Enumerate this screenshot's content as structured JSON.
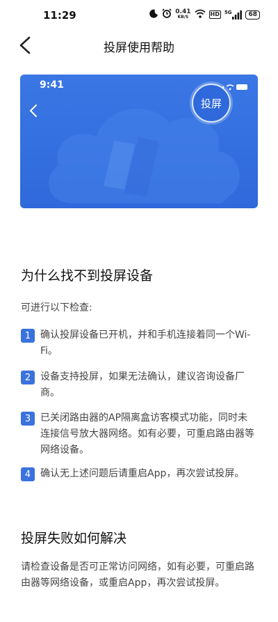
{
  "status_bar": {
    "time": "11:29",
    "speed_value": "0.41",
    "speed_unit": "KB/S",
    "hd": "HD",
    "network": "5G",
    "battery": "68"
  },
  "nav": {
    "title": "投屏使用帮助"
  },
  "banner": {
    "phone_time": "9:41",
    "cast_button": "投屏",
    "colors": {
      "background": "#2f69db",
      "accent": "#3a72de"
    }
  },
  "section1": {
    "title": "为什么找不到投屏设备",
    "intro": "可进行以下检查:",
    "steps": [
      {
        "num": "1",
        "text": "确认投屏设备已开机，并和手机连接着同一个Wi-Fi。"
      },
      {
        "num": "2",
        "text": "设备支持投屏，如果无法确认，建议咨询设备厂商。"
      },
      {
        "num": "3",
        "text": "已关闭路由器的AP隔离盒访客模式功能，同时未连接信号放大器网络。如有必要，可重启路由器等网络设备。"
      },
      {
        "num": "4",
        "text": "确认无上述问题后请重启App，再次尝试投屏。"
      }
    ]
  },
  "section2": {
    "title": "投屏失败如何解决",
    "text": "请检查设备是否可正常访问网络，如有必要，可重启路由器等网络设备，或重启App，再次尝试投屏。"
  }
}
